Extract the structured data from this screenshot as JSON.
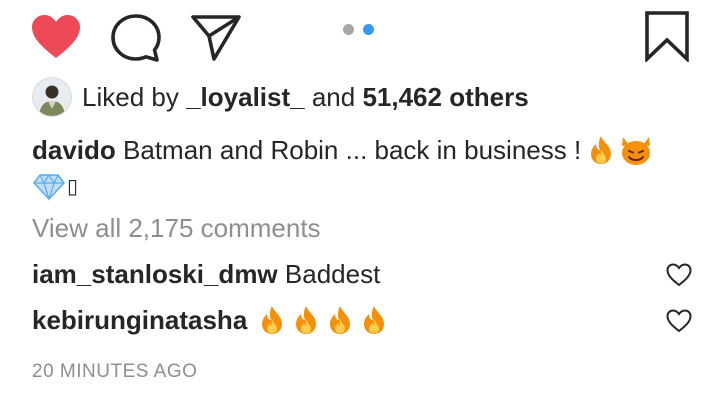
{
  "actions": {
    "like_icon": "heart-filled-icon",
    "comment_icon": "speech-bubble-icon",
    "share_icon": "paper-plane-icon",
    "save_icon": "bookmark-icon",
    "like_color": "#ed4956"
  },
  "carousel": {
    "total": 2,
    "active_index": 2,
    "active_color": "#3897f0",
    "inactive_color": "#a8a8a8"
  },
  "likes": {
    "prefix": "Liked by",
    "user": "_loyalist_",
    "connector": "and",
    "others": "51,462 others"
  },
  "caption": {
    "username": "davido",
    "text": "Batman and Robin ... back in business !",
    "emojis": [
      "fire-emoji",
      "smiling-devil-emoji",
      "gem-emoji"
    ],
    "trailing_glyph": "▯"
  },
  "view_all": "View all 2,175 comments",
  "comments": [
    {
      "username": "iam_stanloski_dmw",
      "text": "Baddest",
      "emojis": []
    },
    {
      "username": "kebirunginatasha",
      "text": "",
      "emojis": [
        "fire-emoji",
        "fire-emoji",
        "fire-emoji",
        "fire-emoji"
      ]
    }
  ],
  "timestamp": "20 MINUTES AGO"
}
